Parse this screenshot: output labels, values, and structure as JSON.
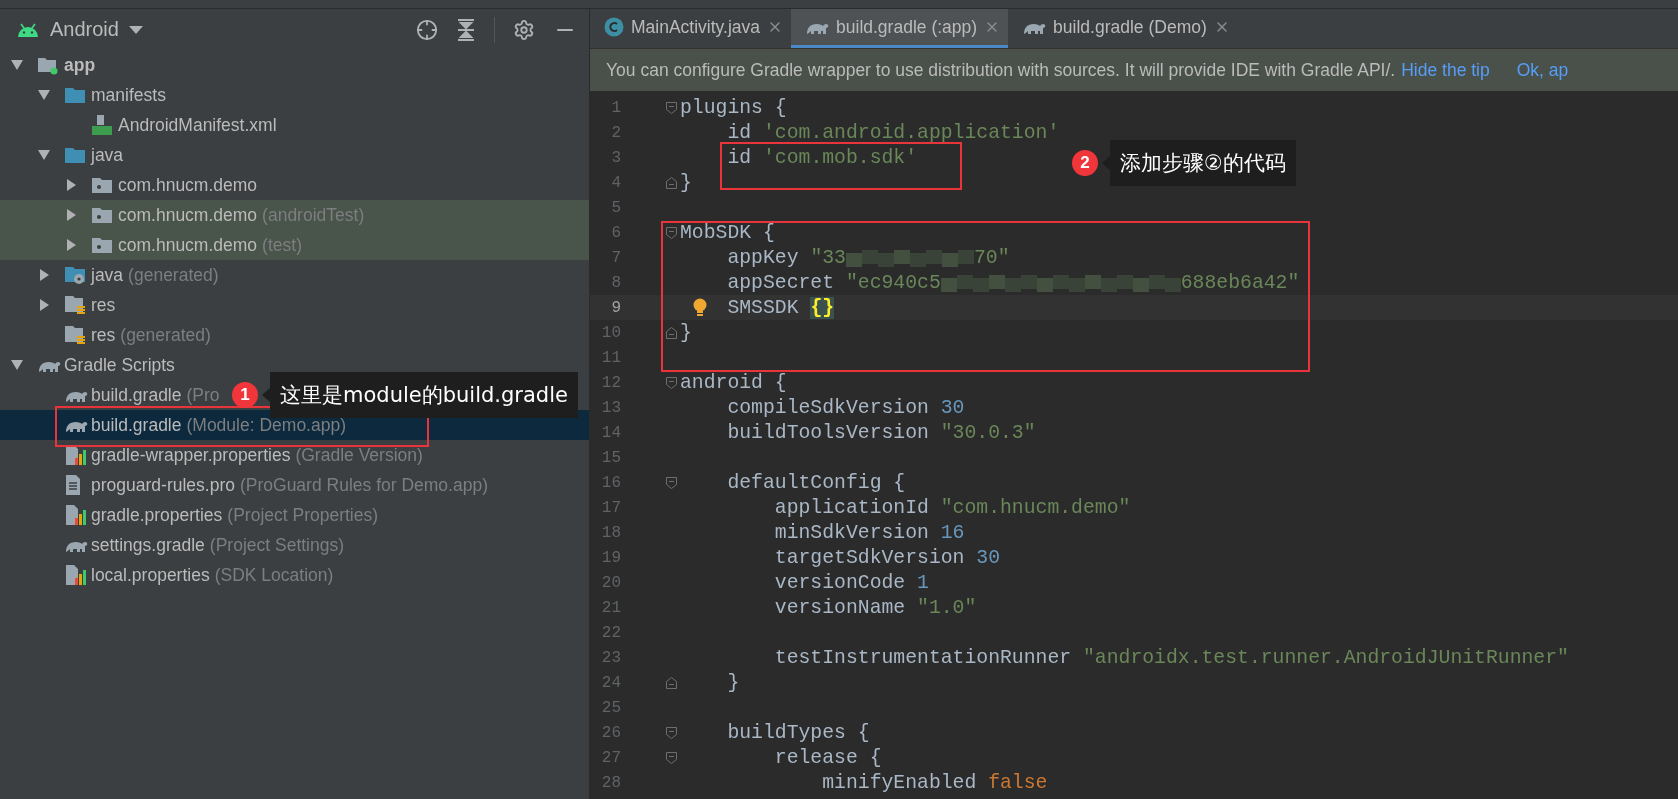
{
  "project_panel": {
    "view": "Android",
    "tree": [
      {
        "label": "app",
        "kind": "module",
        "expanded": true,
        "selected": false,
        "highlighted": false,
        "children": [
          {
            "label": "manifests",
            "kind": "folder",
            "expanded": true,
            "selected": false,
            "highlighted": false,
            "children": [
              {
                "label": "AndroidManifest.xml",
                "kind": "manifest",
                "selected": false,
                "highlighted": false
              }
            ]
          },
          {
            "label": "java",
            "kind": "folder",
            "expanded": true,
            "selected": false,
            "highlighted": false,
            "children": [
              {
                "label": "com.hnucm.demo",
                "kind": "package",
                "expanded": false,
                "selected": false,
                "highlighted": false
              },
              {
                "label": "com.hnucm.demo",
                "suffix": "(androidTest)",
                "kind": "package",
                "expanded": false,
                "selected": false,
                "highlighted": true
              },
              {
                "label": "com.hnucm.demo",
                "suffix": "(test)",
                "kind": "package",
                "expanded": false,
                "selected": false,
                "highlighted": true
              }
            ]
          },
          {
            "label": "java",
            "suffix": "(generated)",
            "kind": "generated",
            "expanded": false,
            "selected": false,
            "highlighted": false
          },
          {
            "label": "res",
            "kind": "res",
            "expanded": false,
            "selected": false,
            "highlighted": false
          },
          {
            "label": "res",
            "suffix": "(generated)",
            "kind": "res",
            "selected": false,
            "highlighted": false
          }
        ]
      },
      {
        "label": "Gradle Scripts",
        "kind": "scripts",
        "expanded": true,
        "selected": false,
        "highlighted": false,
        "children": [
          {
            "label": "build.gradle",
            "suffix": "(Pro",
            "kind": "gradle",
            "selected": false,
            "highlighted": false
          },
          {
            "label": "build.gradle",
            "suffix": "(Module: Demo.app)",
            "kind": "gradle",
            "selected": true,
            "highlighted": false
          },
          {
            "label": "gradle-wrapper.properties",
            "suffix": "(Gradle Version)",
            "kind": "properties",
            "selected": false,
            "highlighted": false
          },
          {
            "label": "proguard-rules.pro",
            "suffix": "(ProGuard Rules for Demo.app)",
            "kind": "file",
            "selected": false,
            "highlighted": false
          },
          {
            "label": "gradle.properties",
            "suffix": "(Project Properties)",
            "kind": "properties",
            "selected": false,
            "highlighted": false
          },
          {
            "label": "settings.gradle",
            "suffix": "(Project Settings)",
            "kind": "gradle",
            "selected": false,
            "highlighted": false
          },
          {
            "label": "local.properties",
            "suffix": "(SDK Location)",
            "kind": "properties",
            "selected": false,
            "highlighted": false
          }
        ]
      }
    ]
  },
  "editor": {
    "tabs": [
      {
        "label": "MainActivity.java",
        "kind": "java",
        "selected": false
      },
      {
        "label": "build.gradle (:app)",
        "kind": "gradle",
        "selected": true
      },
      {
        "label": "build.gradle (Demo)",
        "kind": "gradle",
        "selected": false
      }
    ],
    "tip": {
      "text": "You can configure Gradle wrapper to use distribution with sources. It will provide IDE with Gradle API/.",
      "links": [
        "Hide the tip",
        "Ok, ap"
      ]
    },
    "lines": [
      {
        "number": "1",
        "kind": "fold_start",
        "current": false,
        "bulb": false,
        "tokens": [
          {
            "kind": "plain",
            "text": "plugins {"
          }
        ]
      },
      {
        "number": "2",
        "kind": "plain",
        "current": false,
        "bulb": false,
        "tokens": [
          {
            "kind": "plain",
            "text": "    id "
          },
          {
            "kind": "string",
            "text": "'com.android.application'"
          }
        ]
      },
      {
        "number": "3",
        "kind": "plain",
        "current": false,
        "bulb": false,
        "tokens": [
          {
            "kind": "plain",
            "text": "    id "
          },
          {
            "kind": "string",
            "text": "'com.mob.sdk'"
          }
        ]
      },
      {
        "number": "4",
        "kind": "fold_end",
        "current": false,
        "bulb": false,
        "tokens": [
          {
            "kind": "plain",
            "text": "}"
          }
        ]
      },
      {
        "number": "5",
        "kind": "plain",
        "current": false,
        "bulb": false
      },
      {
        "number": "6",
        "kind": "fold_start",
        "current": false,
        "bulb": false,
        "tokens": [
          {
            "kind": "plain",
            "text": "MobSDK {"
          }
        ]
      },
      {
        "number": "7",
        "kind": "plain",
        "current": false,
        "bulb": false,
        "tokens": [
          {
            "kind": "plain",
            "text": "    appKey "
          },
          {
            "kind": "string",
            "text": "\"33"
          },
          {
            "kind": "redacted_short"
          },
          {
            "kind": "string",
            "text": "70\""
          }
        ]
      },
      {
        "number": "8",
        "kind": "plain",
        "current": false,
        "bulb": false,
        "tokens": [
          {
            "kind": "plain",
            "text": "    appSecret "
          },
          {
            "kind": "string",
            "text": "\"ec940c5"
          },
          {
            "kind": "redacted_long"
          },
          {
            "kind": "string",
            "text": "688eb6a42\""
          }
        ]
      },
      {
        "number": "9",
        "kind": "plain",
        "current": true,
        "bulb": true,
        "tokens": [
          {
            "kind": "plain",
            "text": "    SMSSDK "
          },
          {
            "kind": "match",
            "text": "{}"
          }
        ]
      },
      {
        "number": "10",
        "kind": "fold_end",
        "current": false,
        "bulb": false,
        "tokens": [
          {
            "kind": "plain",
            "text": "}"
          }
        ]
      },
      {
        "number": "11",
        "kind": "plain",
        "current": false,
        "bulb": false
      },
      {
        "number": "12",
        "kind": "fold_start",
        "current": false,
        "bulb": false,
        "tokens": [
          {
            "kind": "plain",
            "text": "android {"
          }
        ]
      },
      {
        "number": "13",
        "kind": "plain",
        "current": false,
        "bulb": false,
        "tokens": [
          {
            "kind": "plain",
            "text": "    compileSdkVersion "
          },
          {
            "kind": "number",
            "text": "30"
          }
        ]
      },
      {
        "number": "14",
        "kind": "plain",
        "current": false,
        "bulb": false,
        "tokens": [
          {
            "kind": "plain",
            "text": "    buildToolsVersion "
          },
          {
            "kind": "string",
            "text": "\"30.0.3\""
          }
        ]
      },
      {
        "number": "15",
        "kind": "plain",
        "current": false,
        "bulb": false
      },
      {
        "number": "16",
        "kind": "fold_start",
        "current": false,
        "bulb": false,
        "tokens": [
          {
            "kind": "plain",
            "text": "    defaultConfig {"
          }
        ]
      },
      {
        "number": "17",
        "kind": "plain",
        "current": false,
        "bulb": false,
        "tokens": [
          {
            "kind": "plain",
            "text": "        applicationId "
          },
          {
            "kind": "string",
            "text": "\"com.hnucm.demo\""
          }
        ]
      },
      {
        "number": "18",
        "kind": "plain",
        "current": false,
        "bulb": false,
        "tokens": [
          {
            "kind": "plain",
            "text": "        minSdkVersion "
          },
          {
            "kind": "number",
            "text": "16"
          }
        ]
      },
      {
        "number": "19",
        "kind": "plain",
        "current": false,
        "bulb": false,
        "tokens": [
          {
            "kind": "plain",
            "text": "        targetSdkVersion "
          },
          {
            "kind": "number",
            "text": "30"
          }
        ]
      },
      {
        "number": "20",
        "kind": "plain",
        "current": false,
        "bulb": false,
        "tokens": [
          {
            "kind": "plain",
            "text": "        versionCode "
          },
          {
            "kind": "number",
            "text": "1"
          }
        ]
      },
      {
        "number": "21",
        "kind": "plain",
        "current": false,
        "bulb": false,
        "tokens": [
          {
            "kind": "plain",
            "text": "        versionName "
          },
          {
            "kind": "string",
            "text": "\"1.0\""
          }
        ]
      },
      {
        "number": "22",
        "kind": "plain",
        "current": false,
        "bulb": false
      },
      {
        "number": "23",
        "kind": "plain",
        "current": false,
        "bulb": false,
        "tokens": [
          {
            "kind": "plain",
            "text": "        testInstrumentationRunner "
          },
          {
            "kind": "string",
            "text": "\"androidx.test.runner.AndroidJUnitRunner\""
          }
        ]
      },
      {
        "number": "24",
        "kind": "fold_end",
        "current": false,
        "bulb": false,
        "tokens": [
          {
            "kind": "plain",
            "text": "    }"
          }
        ]
      },
      {
        "number": "25",
        "kind": "plain",
        "current": false,
        "bulb": false
      },
      {
        "number": "26",
        "kind": "fold_start",
        "current": false,
        "bulb": false,
        "tokens": [
          {
            "kind": "plain",
            "text": "    buildTypes {"
          }
        ]
      },
      {
        "number": "27",
        "kind": "fold_start",
        "current": false,
        "bulb": false,
        "tokens": [
          {
            "kind": "plain",
            "text": "        release {"
          }
        ]
      },
      {
        "number": "28",
        "kind": "plain",
        "current": false,
        "bulb": false,
        "tokens": [
          {
            "kind": "plain",
            "text": "            minifyEnabled "
          },
          {
            "kind": "keyword",
            "text": "false"
          }
        ]
      }
    ]
  },
  "annotations": [
    {
      "kind": "tree",
      "badge": "1",
      "text": "这里是module的build.gradle"
    },
    {
      "kind": "code",
      "badge": "2",
      "text": "添加步骤②的代码"
    }
  ]
}
